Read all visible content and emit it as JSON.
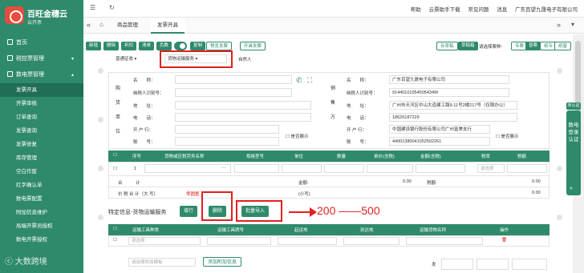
{
  "brand": {
    "title": "百旺金穗云",
    "subtitle": "云开票"
  },
  "sidebar": {
    "items": [
      {
        "label": "首页"
      },
      {
        "label": "税控票管理"
      },
      {
        "label": "数电票管理"
      }
    ],
    "sub": [
      "发票开具",
      "开票审核",
      "订单查询",
      "发票查询",
      "发票修复",
      "库存管理",
      "空白作废",
      "红字确认单",
      "数电票配置",
      "附加信息维护",
      "局端开票员授权",
      "数电开票授权"
    ]
  },
  "topbar": {
    "links": [
      "帮助",
      "云票助手下载",
      "常见问题",
      "消息",
      "广东百望九晟电子有限公司"
    ]
  },
  "tabs": [
    "商品管理",
    "发票开具"
  ],
  "toolbar": {
    "buttons": [
      "新增",
      "删除",
      "折扣",
      "清单",
      "负数",
      "复制",
      "预览发票",
      "开具发票"
    ],
    "right_buttons": [
      "存草稿",
      "草稿箱"
    ],
    "ticket_label": "请选择票种:",
    "ticket_types": [
      "专票",
      "普票",
      "纸专",
      "纸普"
    ]
  },
  "form": {
    "invoice_type": "普通征收",
    "scene": "货物运输服务",
    "self_issue": "自然人",
    "buyer_vertical": "购货单位",
    "buyer_labels": [
      "名　　称：",
      "纳税人识别号：",
      "地　　址：",
      "电　　话：",
      "开 户 行：",
      "账　　号："
    ],
    "seller_vertical": "销售方",
    "seller_labels": [
      "名　　称：",
      "纳税人识别号：",
      "地　　址：",
      "电　　话：",
      "开 户 行：",
      "账　　号："
    ],
    "seller_values": [
      "广东百望九晟电子有限公司",
      "91440101054505434W",
      "广州市天河区中山大道建工路9-11号2楼217号（仅限办公）",
      "18626187229",
      "中国建设银行股份有限公司广州富美支行",
      "44001380041052502261"
    ],
    "show_label": "是否展示"
  },
  "table": {
    "headers": [
      "序号",
      "货物或应税劳务名称",
      "规格型号",
      "单位",
      "数量",
      "单价(含税)",
      "金额(含税)",
      "税率",
      "税额"
    ],
    "row_index": "1",
    "rate_placeholder": "请选择",
    "total_label": "合　　　计",
    "amount_label": "金额:",
    "amount_value": "0.00",
    "tax_label": "税额:",
    "tax_value": "0.00",
    "price_tax_label": "价 税 合 计（大 写）",
    "price_tax_value": "零圆整",
    "lower_label": "(小写)",
    "lower_value": "0.00"
  },
  "special": {
    "title": "特定信息-货物运输服务",
    "add": "增行",
    "delete": "删除",
    "import": "批量导入",
    "headers": [
      "运输工具种类",
      "运输工具牌号",
      "起运地",
      "到达地",
      "运输货物名称",
      "操作"
    ],
    "select_placeholder": "请选择",
    "extra_placeholder": "请选择附加模板",
    "extra_button": "添加附加信息",
    "side_label": "发"
  },
  "annotation": "200 ——500",
  "right_tab": {
    "badge": "未认证",
    "text": "数电登录认证"
  }
}
